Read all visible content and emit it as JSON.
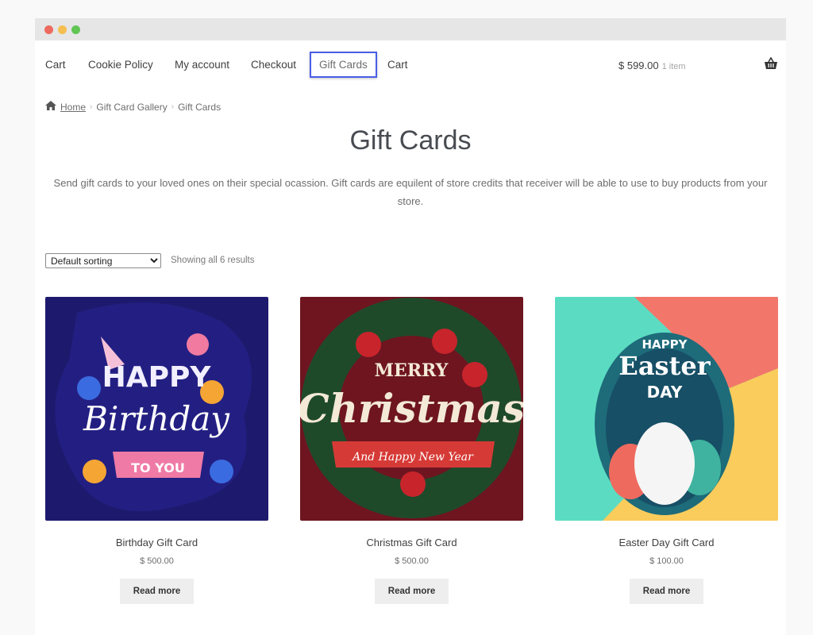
{
  "window": {
    "controls": [
      "close",
      "minimize",
      "maximize"
    ]
  },
  "nav": {
    "items": [
      {
        "label": "Cart"
      },
      {
        "label": "Cookie Policy"
      },
      {
        "label": "My account"
      },
      {
        "label": "Checkout"
      },
      {
        "label": "Gift Cards",
        "active": true
      },
      {
        "label": "Cart"
      }
    ],
    "cart_total": "$ 599.00",
    "cart_count": "1 item",
    "basket_icon": "basket-icon"
  },
  "breadcrumb": {
    "home_icon": "home-icon",
    "items": [
      "Home",
      "Gift Card Gallery",
      "Gift Cards"
    ],
    "separator": "›"
  },
  "page": {
    "title": "Gift Cards",
    "description": "Send gift cards to your loved ones on their special ocassion. Gift cards are equilent of store credits that receiver will be able to use to buy products from your store."
  },
  "toolbar": {
    "sort_selected": "Default sorting",
    "result_count": "Showing all 6 results"
  },
  "products": [
    {
      "name": "Birthday Gift Card",
      "price": "$ 500.00",
      "button": "Read more",
      "image_text": [
        "HAPPY",
        "Birthday",
        "TO YOU"
      ]
    },
    {
      "name": "Christmas Gift Card",
      "price": "$ 500.00",
      "button": "Read more",
      "image_text": [
        "MERRY",
        "Christmas",
        "And Happy New Year"
      ]
    },
    {
      "name": "Easter Day Gift Card",
      "price": "$ 100.00",
      "button": "Read more",
      "image_text": [
        "HAPPY",
        "Easter",
        "DAY"
      ]
    }
  ]
}
